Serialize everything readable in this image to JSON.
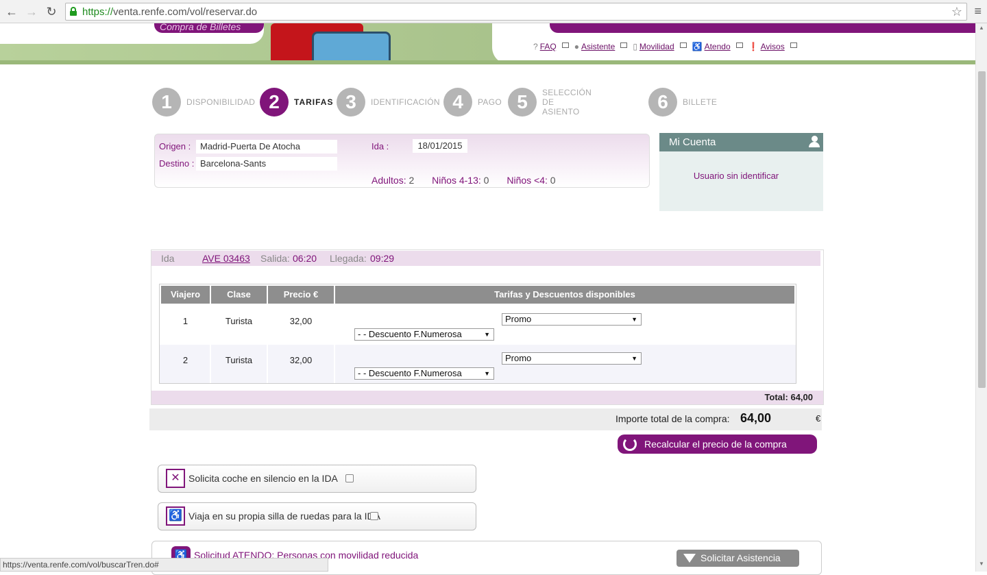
{
  "browser": {
    "url_scheme": "https://",
    "url_rest": "venta.renfe.com/vol/reservar.do",
    "status_url": "https://venta.renfe.com/vol/buscarTren.do#"
  },
  "banner": {
    "section_title": "Compra de Billetes"
  },
  "toplinks": [
    "FAQ",
    "Asistente",
    "Movilidad",
    "Atendo",
    "Avisos"
  ],
  "steps": [
    {
      "num": "1",
      "label": "DISPONIBILIDAD"
    },
    {
      "num": "2",
      "label": "TARIFAS"
    },
    {
      "num": "3",
      "label": "IDENTIFICACIÓN"
    },
    {
      "num": "4",
      "label": "PAGO"
    },
    {
      "num": "5",
      "label": "SELECCIÓN DE ASIENTO"
    },
    {
      "num": "6",
      "label": "BILLETE"
    }
  ],
  "summary": {
    "origen_label": "Origen :",
    "origen_value": "Madrid-Puerta De Atocha",
    "destino_label": "Destino :",
    "destino_value": "Barcelona-Sants",
    "ida_label": "Ida :",
    "ida_value": "18/01/2015",
    "adultos_label": "Adultos:",
    "adultos_value": "2",
    "ninos_label": "Niños 4-13:",
    "ninos_value": "0",
    "ninos_small_label": "Niños <4:",
    "ninos_small_value": "0"
  },
  "account": {
    "title": "Mi Cuenta",
    "user": "Usuario sin identificar"
  },
  "trip": {
    "direction": "Ida",
    "train": "AVE 03463",
    "salida_label": "Salida:",
    "salida_value": "06:20",
    "llegada_label": "Llegada:",
    "llegada_value": "09:29",
    "columns": [
      "Viajero",
      "Clase",
      "Precio €",
      "Tarifas y Descuentos disponibles"
    ],
    "rows": [
      {
        "viajero": "1",
        "clase": "Turista",
        "precio": "32,00",
        "tarifa": "Promo",
        "descuento": "- - Descuento F.Numerosa"
      },
      {
        "viajero": "2",
        "clase": "Turista",
        "precio": "32,00",
        "tarifa": "Promo",
        "descuento": "- - Descuento F.Numerosa"
      }
    ],
    "total": "Total: 64,00"
  },
  "purchase": {
    "total_label": "Importe total de la compra:",
    "total_value": "64,00",
    "currency": "€",
    "recalc_label": "Recalcular el precio de la compra"
  },
  "options": {
    "silencio_label": "Solicita coche en silencio en la IDA",
    "silla_label": "Viaja en su propia silla de ruedas para la IDA",
    "atendo_label": "Solicitud ATENDO: Personas con movilidad reducida",
    "asistencia_label": "Solicitar Asistencia"
  },
  "colors": {
    "brand": "#80157a",
    "header_gray": "#8e8e8e",
    "account_head": "#6b8a88"
  }
}
